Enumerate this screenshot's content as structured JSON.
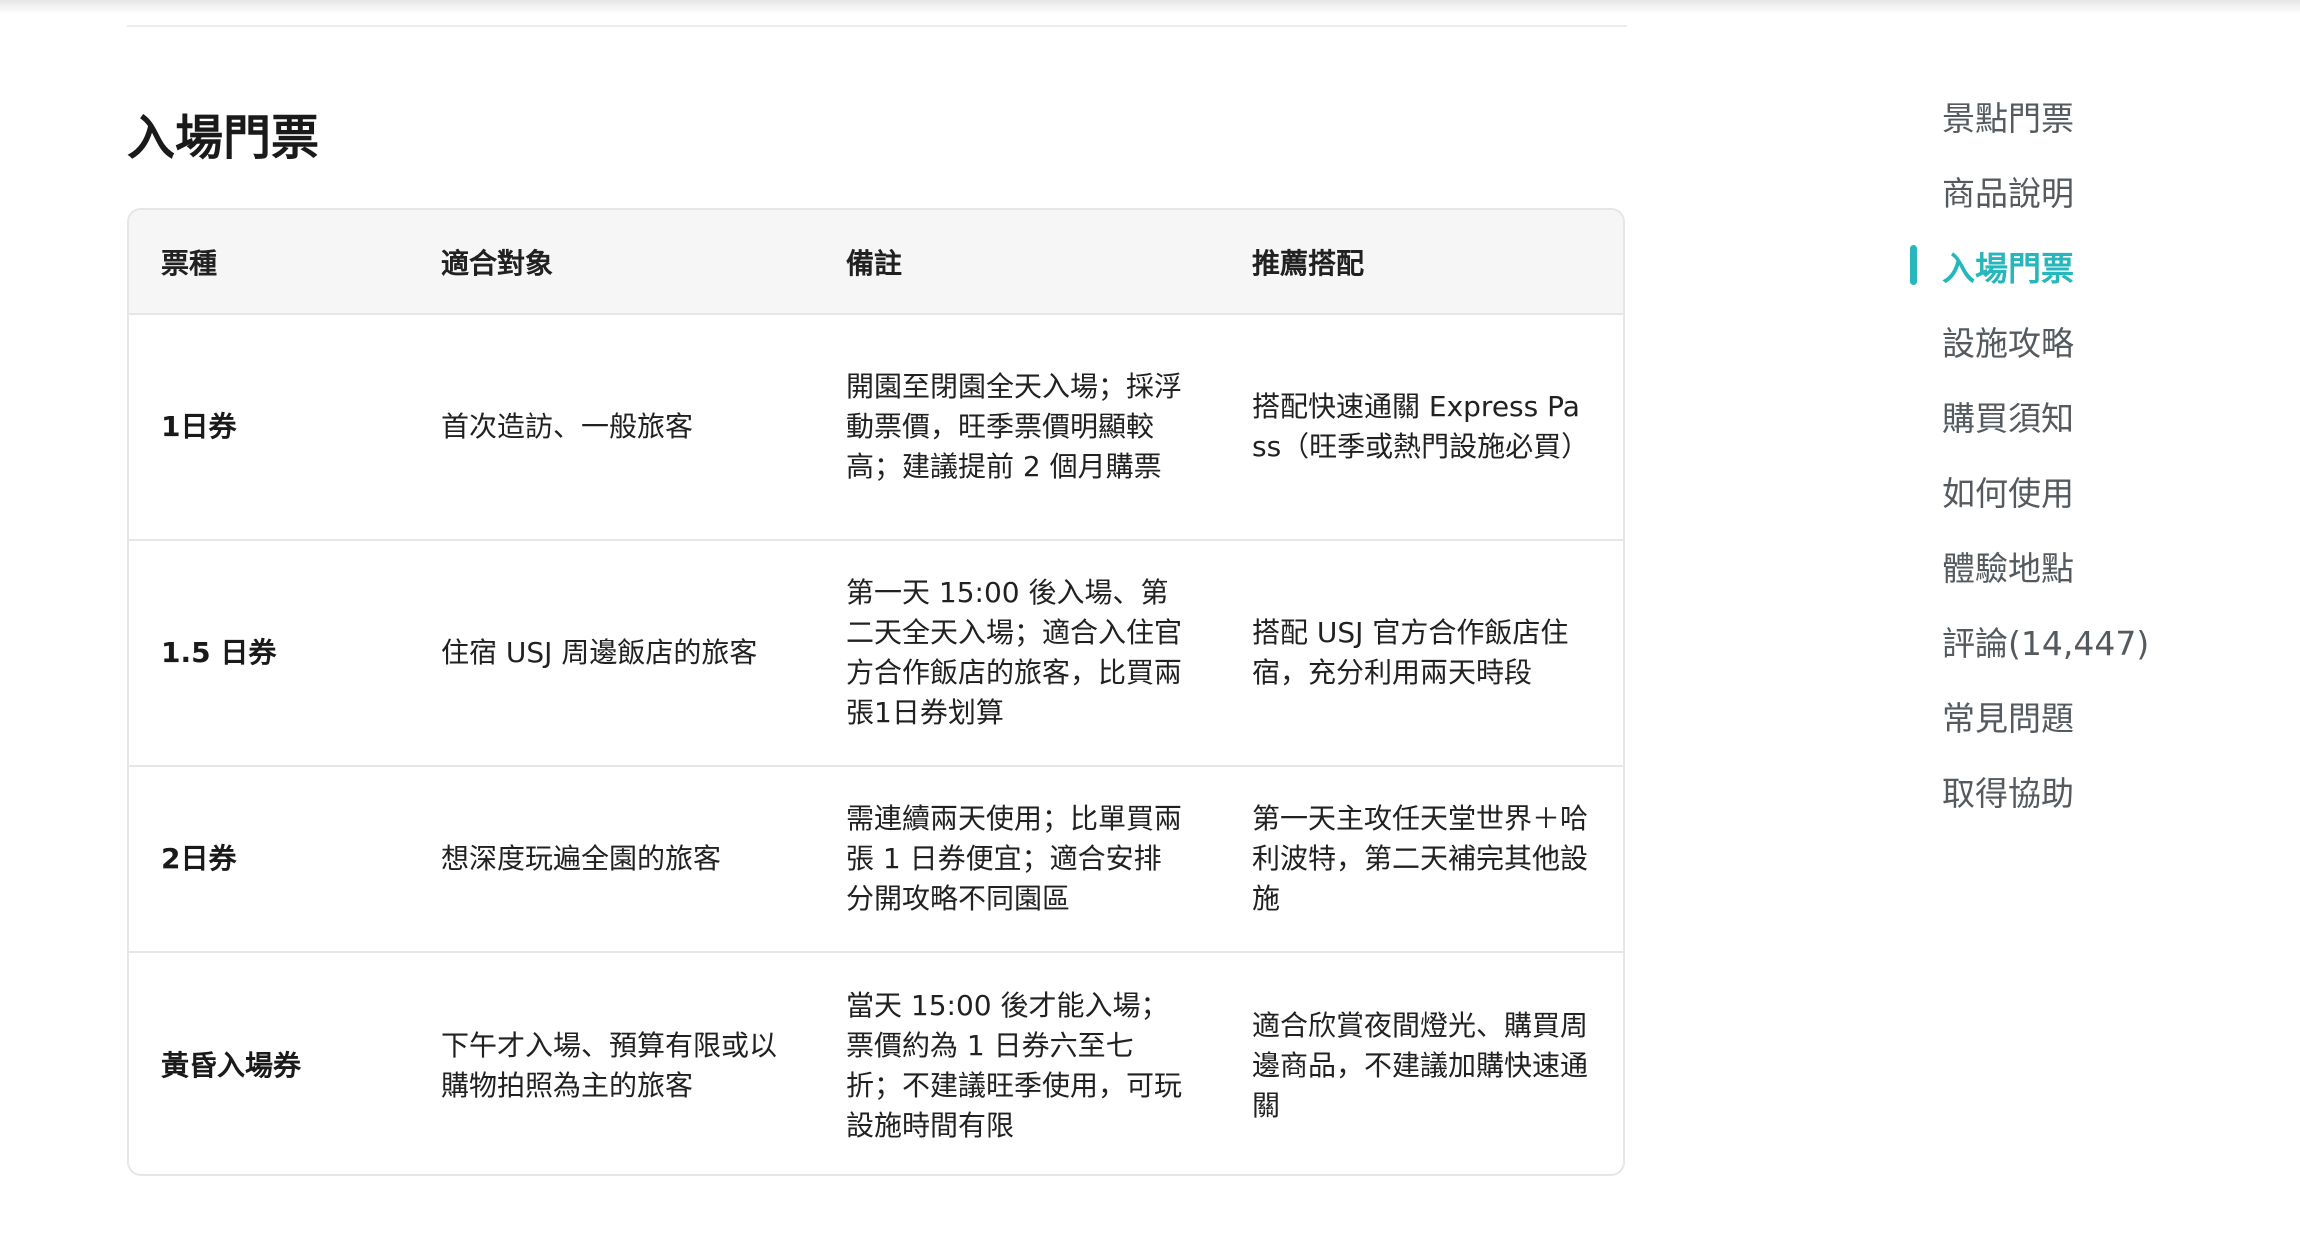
{
  "section": {
    "title": "入場門票"
  },
  "table": {
    "headers": [
      "票種",
      "適合對象",
      "備註",
      "推薦搭配"
    ],
    "rows": [
      {
        "type": "1日券",
        "audience": "首次造訪、一般旅客",
        "note": "開園至閉園全天入場；採浮動票價，旺季票價明顯較高；建議提前 2 個月購票",
        "recommend": "搭配快速通關 Express Pass（旺季或熱門設施必買）"
      },
      {
        "type": "1.5 日券",
        "audience": "住宿 USJ 周邊飯店的旅客",
        "note": "第一天 15:00 後入場、第二天全天入場；適合入住官方合作飯店的旅客，比買兩張1日券划算",
        "recommend": "搭配 USJ 官方合作飯店住宿，充分利用兩天時段"
      },
      {
        "type": "2日券",
        "audience": "想深度玩遍全園的旅客",
        "note": "需連續兩天使用；比單買兩張 1 日券便宜；適合安排分開攻略不同園區",
        "recommend": "第一天主攻任天堂世界＋哈利波特，第二天補完其他設施"
      },
      {
        "type": "黃昏入場券",
        "audience": "下午才入場、預算有限或以購物拍照為主的旅客",
        "note": "當天 15:00 後才能入場；票價約為 1 日券六至七折；不建議旺季使用，可玩設施時間有限",
        "recommend": "適合欣賞夜間燈光、購買周邊商品，不建議加購快速通關"
      }
    ]
  },
  "toc": {
    "items": [
      "景點門票",
      "商品說明",
      "入場門票",
      "設施攻略",
      "購買須知",
      "如何使用",
      "體驗地點",
      "評論(14,447)",
      "常見問題",
      "取得協助"
    ],
    "active_index": 2
  },
  "colors": {
    "accent": "#26b7bc",
    "text": "#212121",
    "muted": "#555a5e",
    "border": "#e6e6e6",
    "header_bg": "#f6f6f7"
  }
}
